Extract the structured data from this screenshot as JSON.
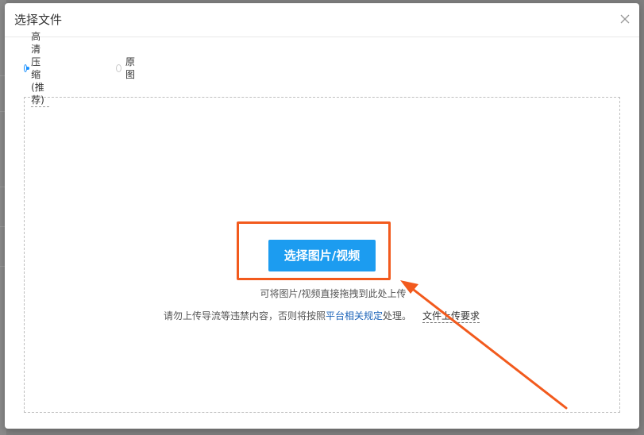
{
  "dialog": {
    "title": "选择文件",
    "close_icon": "close-icon"
  },
  "options": {
    "compress_label": "高清压缩 (推荐)",
    "original_label": "原图",
    "selected": "compress"
  },
  "upload": {
    "button_label": "选择图片/视频",
    "drag_hint": "可将图片/视频直接拖拽到此处上传",
    "rules_prefix": "请勿上传导流等违禁内容，否则将按照",
    "rules_link": "平台相关规定",
    "rules_suffix": "处理。",
    "file_requirements": "文件上传要求"
  },
  "annotation": {
    "highlight_color": "#f25a1d",
    "arrow_color": "#f25a1d"
  },
  "colors": {
    "primary": "#1c9cf0",
    "link": "#1c63b8",
    "radio_checked": "#1890ff"
  }
}
